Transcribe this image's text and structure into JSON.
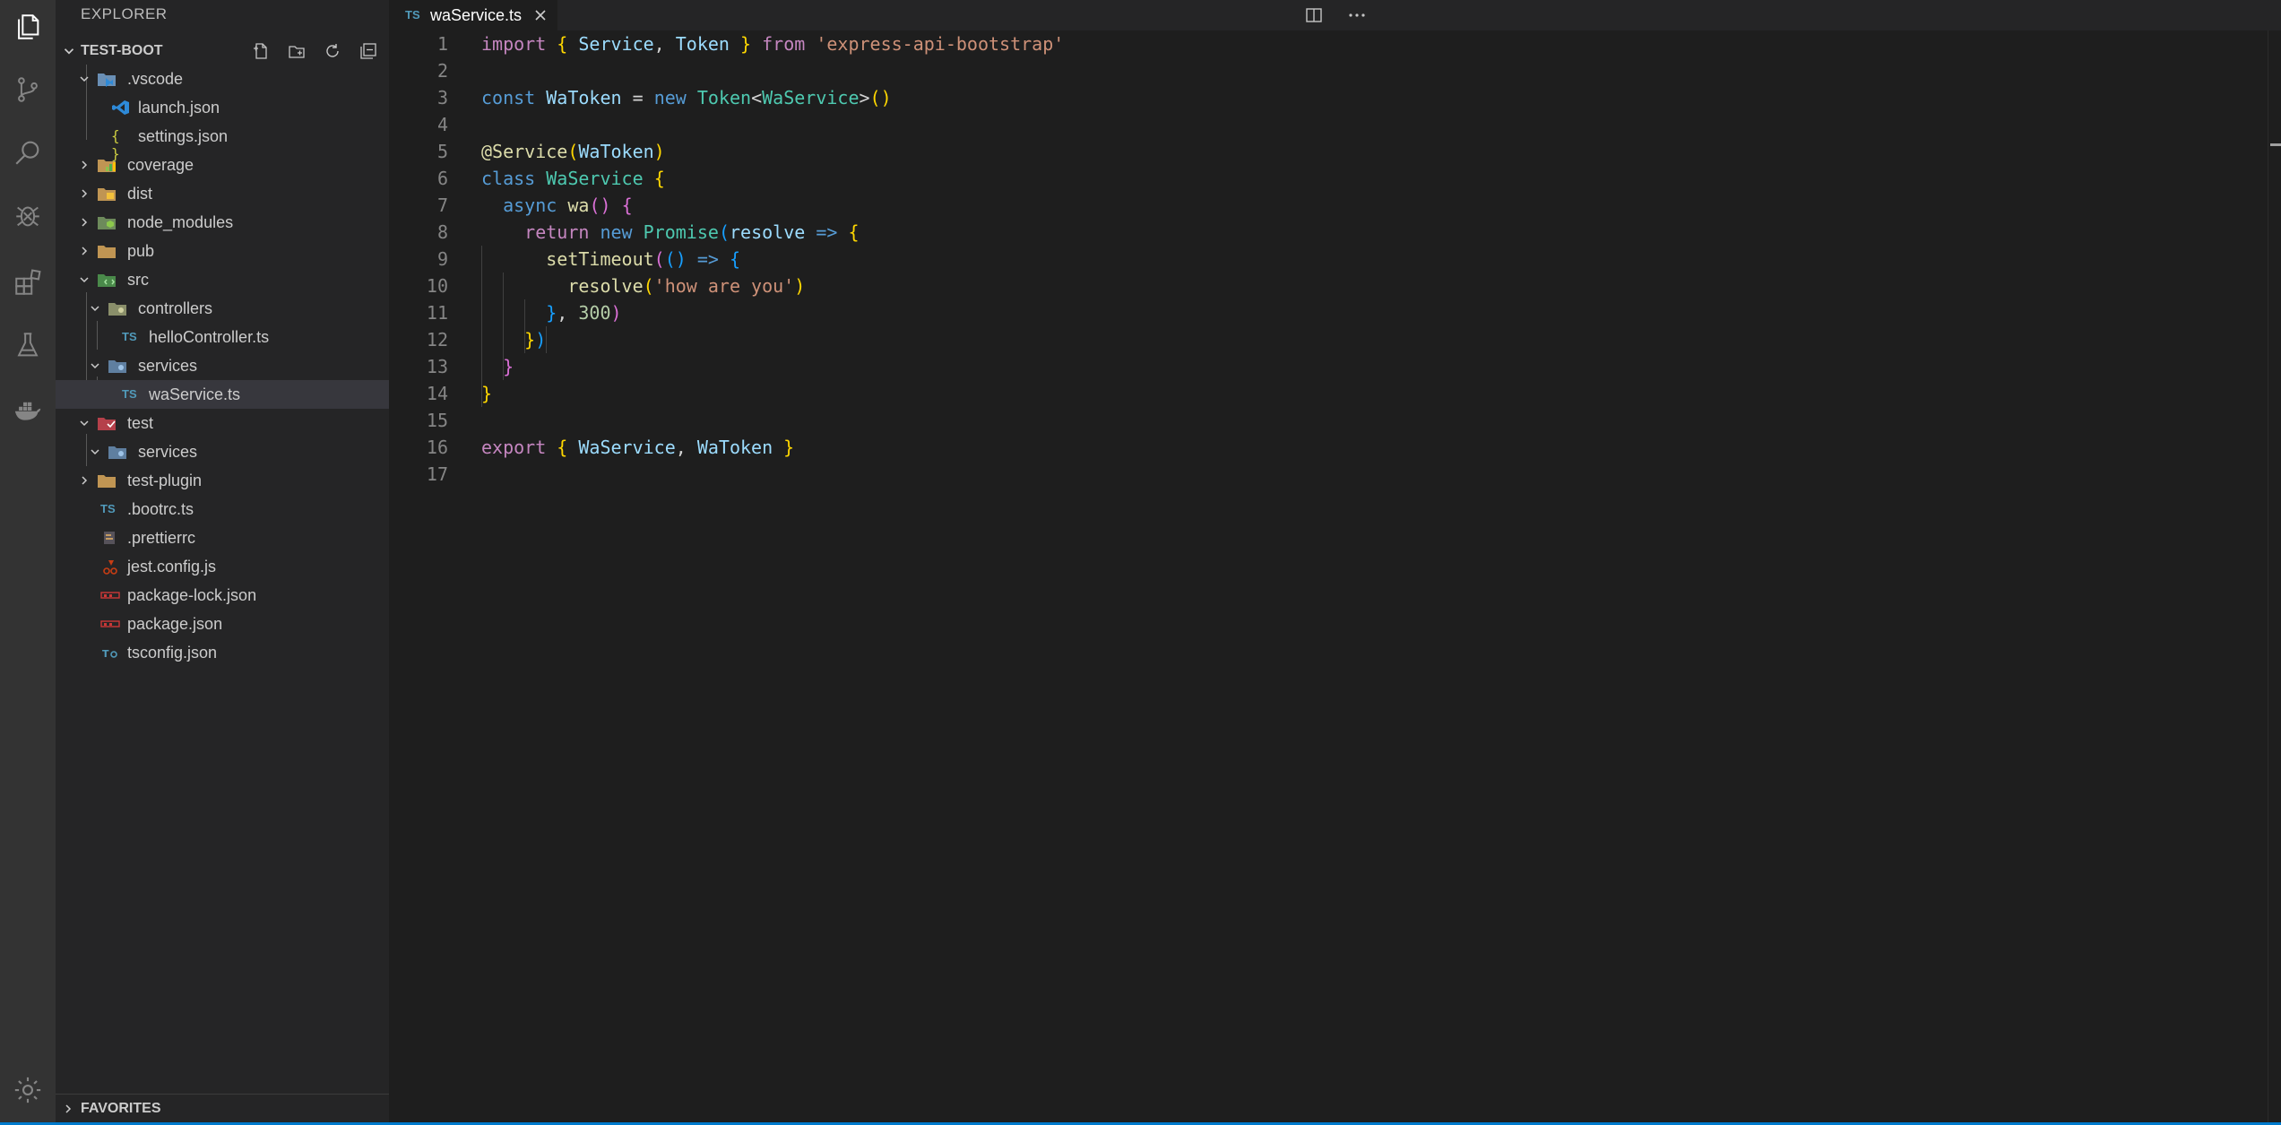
{
  "sidebar": {
    "title": "EXPLORER",
    "section_title": "TEST-BOOT",
    "favorites_title": "FAVORITES",
    "tree": [
      {
        "label": ".vscode"
      },
      {
        "label": "launch.json"
      },
      {
        "label": "settings.json"
      },
      {
        "label": "coverage"
      },
      {
        "label": "dist"
      },
      {
        "label": "node_modules"
      },
      {
        "label": "pub"
      },
      {
        "label": "src"
      },
      {
        "label": "controllers"
      },
      {
        "label": "helloController.ts"
      },
      {
        "label": "services"
      },
      {
        "label": "waService.ts"
      },
      {
        "label": "test"
      },
      {
        "label": "services"
      },
      {
        "label": "test-plugin"
      },
      {
        "label": ".bootrc.ts"
      },
      {
        "label": ".prettierrc"
      },
      {
        "label": "jest.config.js"
      },
      {
        "label": "package-lock.json"
      },
      {
        "label": "package.json"
      },
      {
        "label": "tsconfig.json"
      }
    ]
  },
  "tab": {
    "label": "waService.ts",
    "type_badge": "TS"
  },
  "editor": {
    "line_numbers": [
      "1",
      "2",
      "3",
      "4",
      "5",
      "6",
      "7",
      "8",
      "9",
      "10",
      "11",
      "12",
      "13",
      "14",
      "15",
      "16",
      "17"
    ],
    "tokens": {
      "l1_import": "import",
      "l1_open": " { ",
      "l1_service": "Service",
      "l1_comma": ", ",
      "l1_token": "Token",
      "l1_close": " } ",
      "l1_from": "from",
      "l1_sp": " ",
      "l1_str": "'express-api-bootstrap'",
      "l3_const": "const",
      "l3_sp": " ",
      "l3_watoken": "WaToken",
      "l3_eq": " = ",
      "l3_new": "new",
      "l3_sp2": " ",
      "l3_token": "Token",
      "l3_lt": "<",
      "l3_waservice": "WaService",
      "l3_gt": ">",
      "l3_paren": "()",
      "l5_at": "@Service",
      "l5_open": "(",
      "l5_watoken": "WaToken",
      "l5_close": ")",
      "l6_class": "class",
      "l6_sp": " ",
      "l6_waservice": "WaService",
      "l6_sp2": " ",
      "l6_brace": "{",
      "l7_async": "async",
      "l7_sp": " ",
      "l7_wa": "wa",
      "l7_paren": "()",
      "l7_sp2": " ",
      "l7_brace": "{",
      "l8_return": "return",
      "l8_sp": " ",
      "l8_new": "new",
      "l8_sp2": " ",
      "l8_promise": "Promise",
      "l8_open": "(",
      "l8_resolve": "resolve",
      "l8_sp3": " ",
      "l8_arrow": "=>",
      "l8_sp4": " ",
      "l8_brace": "{",
      "l9_settimeout": "setTimeout",
      "l9_open": "(",
      "l9_paren": "()",
      "l9_sp": " ",
      "l9_arrow": "=>",
      "l9_sp2": " ",
      "l9_brace": "{",
      "l10_resolve": "resolve",
      "l10_open": "(",
      "l10_str": "'how are you'",
      "l10_close": ")",
      "l11_brace": "}",
      "l11_comma": ", ",
      "l11_num": "300",
      "l11_close": ")",
      "l12_brace": "}",
      "l12_close": ")",
      "l13_brace": "}",
      "l14_brace": "}",
      "l16_export": "export",
      "l16_open": " { ",
      "l16_waservice": "WaService",
      "l16_comma": ", ",
      "l16_watoken": "WaToken",
      "l16_close": " }"
    }
  }
}
